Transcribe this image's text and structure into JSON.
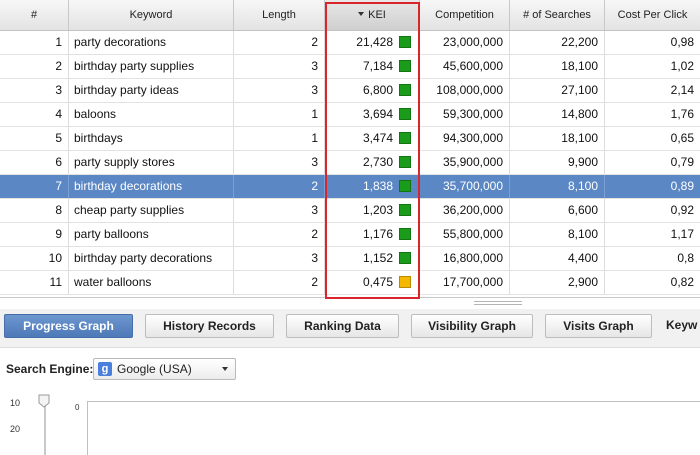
{
  "table": {
    "headers": {
      "index": "#",
      "keyword": "Keyword",
      "length": "Length",
      "kei": "KEI",
      "competition": "Competition",
      "searches": "# of Searches",
      "cpc": "Cost Per Click"
    },
    "sorted_column": "KEI",
    "colors": {
      "green": "#1a9c1a",
      "yellow": "#f5b800",
      "selected_row": "#5b87c4",
      "highlight_box": "#d9252b"
    },
    "rows": [
      {
        "index": "1",
        "keyword": "party decorations",
        "length": "2",
        "kei": "21,428",
        "kei_color": "green",
        "competition": "23,000,000",
        "searches": "22,200",
        "cpc": "0,98"
      },
      {
        "index": "2",
        "keyword": "birthday party supplies",
        "length": "3",
        "kei": "7,184",
        "kei_color": "green",
        "competition": "45,600,000",
        "searches": "18,100",
        "cpc": "1,02"
      },
      {
        "index": "3",
        "keyword": "birthday party ideas",
        "length": "3",
        "kei": "6,800",
        "kei_color": "green",
        "competition": "108,000,000",
        "searches": "27,100",
        "cpc": "2,14"
      },
      {
        "index": "4",
        "keyword": "baloons",
        "length": "1",
        "kei": "3,694",
        "kei_color": "green",
        "competition": "59,300,000",
        "searches": "14,800",
        "cpc": "1,76"
      },
      {
        "index": "5",
        "keyword": "birthdays",
        "length": "1",
        "kei": "3,474",
        "kei_color": "green",
        "competition": "94,300,000",
        "searches": "18,100",
        "cpc": "0,65"
      },
      {
        "index": "6",
        "keyword": "party supply stores",
        "length": "3",
        "kei": "2,730",
        "kei_color": "green",
        "competition": "35,900,000",
        "searches": "9,900",
        "cpc": "0,79"
      },
      {
        "index": "7",
        "keyword": "birthday decorations",
        "length": "2",
        "kei": "1,838",
        "kei_color": "green",
        "competition": "35,700,000",
        "searches": "8,100",
        "cpc": "0,89",
        "selected": true
      },
      {
        "index": "8",
        "keyword": "cheap party supplies",
        "length": "3",
        "kei": "1,203",
        "kei_color": "green",
        "competition": "36,200,000",
        "searches": "6,600",
        "cpc": "0,92"
      },
      {
        "index": "9",
        "keyword": "party balloons",
        "length": "2",
        "kei": "1,176",
        "kei_color": "green",
        "competition": "55,800,000",
        "searches": "8,100",
        "cpc": "1,17"
      },
      {
        "index": "10",
        "keyword": "birthday party decorations",
        "length": "3",
        "kei": "1,152",
        "kei_color": "green",
        "competition": "16,800,000",
        "searches": "4,400",
        "cpc": "0,8"
      },
      {
        "index": "11",
        "keyword": "water balloons",
        "length": "2",
        "kei": "0,475",
        "kei_color": "yellow",
        "competition": "17,700,000",
        "searches": "2,900",
        "cpc": "0,82"
      }
    ]
  },
  "tabs": [
    {
      "label": "Progress Graph",
      "active": true
    },
    {
      "label": "History Records"
    },
    {
      "label": "Ranking Data"
    },
    {
      "label": "Visibility Graph"
    },
    {
      "label": "Visits Graph"
    },
    {
      "label": "Keyw"
    }
  ],
  "search_engine": {
    "label": "Search Engine:",
    "selected": "Google (USA)",
    "icon": "google-g-icon"
  },
  "graph": {
    "y_ticks": [
      "10",
      "20"
    ],
    "zero_label": "0"
  }
}
